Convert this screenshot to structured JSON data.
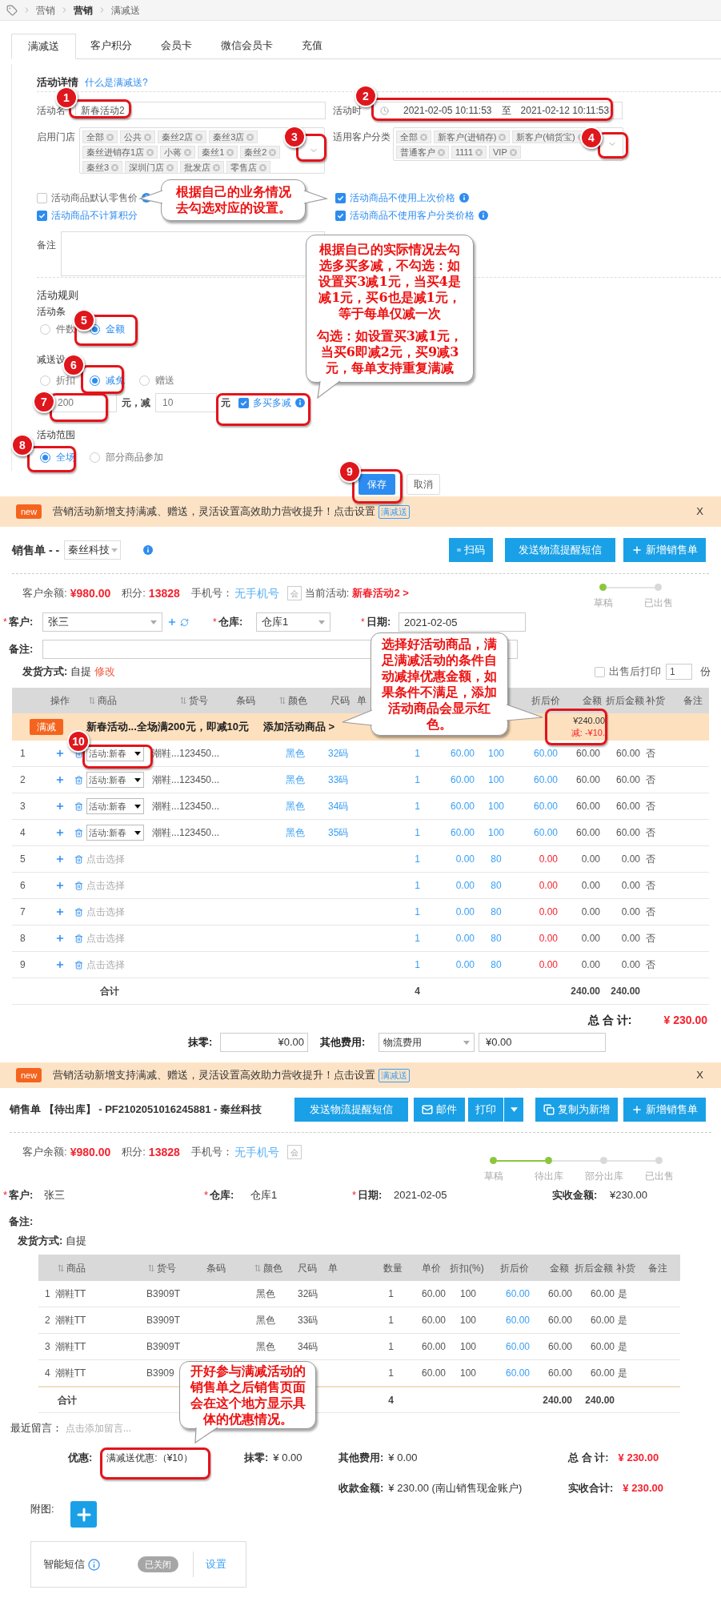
{
  "breadcrumb": [
    {
      "label": "营销",
      "selected": false
    },
    {
      "label": "营销",
      "selected": true
    },
    {
      "label": "满减送",
      "selected": false
    }
  ],
  "tabs": [
    {
      "label": "满减送",
      "selected": true
    },
    {
      "label": "客户积分",
      "selected": false
    },
    {
      "label": "会员卡",
      "selected": false
    },
    {
      "label": "微信会员卡",
      "selected": false
    },
    {
      "label": "充值",
      "selected": false
    }
  ],
  "activity_form": {
    "title": "活动详情",
    "help_link": "什么是满减送?",
    "name": {
      "label": "活动名",
      "value": "新春活动2"
    },
    "period": {
      "label": "活动时",
      "start": "2021-02-05 10:11:53",
      "separator": "至",
      "end": "2021-02-12 10:11:53"
    },
    "stores": {
      "label": "启用门店",
      "tags": [
        "全部",
        "公共",
        "秦丝2店",
        "秦丝3店",
        "秦丝进销存1店",
        "小蒋",
        "秦丝1",
        "秦丝2",
        "秦丝3",
        "深圳门店",
        "批发店",
        "零售店"
      ]
    },
    "customer_types": {
      "label": "适用客户分类",
      "tags": [
        "全部",
        "新客户(进销存)",
        "新客户(销货宝)",
        "普通客户",
        "1111",
        "VIP"
      ]
    },
    "options": [
      {
        "label": "活动商品默认零售价",
        "checked": false,
        "info": true
      },
      {
        "label": "活动商品不使用上次价格",
        "checked": true,
        "info": true
      },
      {
        "label": "活动商品不计算积分",
        "checked": true,
        "info": false
      },
      {
        "label": "活动商品不使用客户分类价格",
        "checked": true,
        "info": true
      }
    ],
    "note_label": "备注",
    "rules_title": "活动规则",
    "condition": {
      "label": "活动条",
      "options": [
        {
          "label": "件数",
          "selected": false
        },
        {
          "label": "金额",
          "selected": true
        }
      ]
    },
    "reduction": {
      "label": "减送设",
      "options": [
        {
          "label": "折扣",
          "selected": false
        },
        {
          "label": "减免",
          "selected": true
        },
        {
          "label": "赠送",
          "selected": false
        }
      ]
    },
    "threshold": "200",
    "threshold_suffix": "元，减",
    "amount": "10",
    "amount_suffix": "元",
    "repeat": {
      "label": "多买多减",
      "checked": true
    },
    "scope": {
      "label": "活动范围",
      "options": [
        {
          "label": "全场",
          "selected": true
        },
        {
          "label": "部分商品参加",
          "selected": false
        }
      ]
    },
    "buttons": [
      "保存",
      "取消"
    ]
  },
  "draft_order": {
    "banner": {
      "badge": "new",
      "text": "营销活动新增支持满减、赠送，灵活设置高效助力营收提升！点击设置",
      "link": "满减送",
      "close": "X"
    },
    "title": "销售单 - -",
    "company": "秦丝科技",
    "actions": [
      {
        "label": "扫码",
        "kind": "scan"
      },
      {
        "label": "发送物流提醒短信",
        "kind": "text"
      },
      {
        "label": "新增销售单",
        "kind": "add"
      }
    ],
    "balance": {
      "label": "客户余额:",
      "value": "¥980.00"
    },
    "points": {
      "label": "积分:",
      "value": "13828"
    },
    "phone": {
      "label": "手机号：",
      "value": "无手机号"
    },
    "member_badge": "会",
    "activity": {
      "label": "当前活动:",
      "value": "新春活动2 >"
    },
    "steps": [
      {
        "label": "草稿",
        "done": true
      },
      {
        "label": "已出售",
        "done": false
      }
    ],
    "customer": {
      "mark": "*",
      "label": "客户:",
      "value": "张三"
    },
    "warehouse": {
      "mark": "*",
      "label": "仓库:",
      "value": "仓库1"
    },
    "date": {
      "mark": "*",
      "label": "日期:",
      "value": "2021-02-05"
    },
    "note_label": "备注:",
    "shipping": {
      "label": "发货方式:",
      "value": "自提",
      "edit": "修改"
    },
    "print_after": {
      "label": "出售后打印",
      "checked": false,
      "copies": "1",
      "unit": "份"
    },
    "columns": [
      {
        "label": "操作",
        "sortable": false
      },
      {
        "label": "商品",
        "sortable": true
      },
      {
        "label": "货号",
        "sortable": true
      },
      {
        "label": "条码",
        "sortable": false
      },
      {
        "label": "颜色",
        "sortable": true
      },
      {
        "label": "尺码",
        "sortable": false
      },
      {
        "label": "单",
        "sortable": false
      },
      {
        "label": "折后价",
        "sortable": false
      },
      {
        "label": "金额",
        "sortable": false
      },
      {
        "label": "折后金额",
        "sortable": false
      },
      {
        "label": "补货",
        "sortable": false
      },
      {
        "label": "备注",
        "sortable": false
      }
    ],
    "promo": {
      "badge": "满减",
      "text": "新春活动...全场满200元，即减10元",
      "link": "添加活动商品 >",
      "amount": "¥240.00",
      "discount": "减: -¥10."
    },
    "rows": [
      {
        "kind": "product",
        "index": "1",
        "activity": "活动:新春",
        "product": "潮鞋...123450...",
        "color_name": "黑色",
        "size": "32码",
        "qty": "1",
        "price": "60.00",
        "discount": "100",
        "net_price": "60.00",
        "amount": "60.00",
        "net_amount": "60.00",
        "restock": "否"
      },
      {
        "kind": "product",
        "index": "2",
        "activity": "活动:新春",
        "product": "潮鞋...123450...",
        "color_name": "黑色",
        "size": "33码",
        "qty": "1",
        "price": "60.00",
        "discount": "100",
        "net_price": "60.00",
        "amount": "60.00",
        "net_amount": "60.00",
        "restock": "否"
      },
      {
        "kind": "product",
        "index": "3",
        "activity": "活动:新春",
        "product": "潮鞋...123450...",
        "color_name": "黑色",
        "size": "34码",
        "qty": "1",
        "price": "60.00",
        "discount": "100",
        "net_price": "60.00",
        "amount": "60.00",
        "net_amount": "60.00",
        "restock": "否"
      },
      {
        "kind": "product",
        "index": "4",
        "activity": "活动:新春",
        "product": "潮鞋...123450...",
        "color_name": "黑色",
        "size": "35码",
        "qty": "1",
        "price": "60.00",
        "discount": "100",
        "net_price": "60.00",
        "amount": "60.00",
        "net_amount": "60.00",
        "restock": "否"
      },
      {
        "kind": "empty",
        "index": "5",
        "placeholder": "点击选择",
        "qty": "1",
        "price": "0.00",
        "discount": "80",
        "net_price": "0.00",
        "amount": "0.00",
        "net_amount": "0.00",
        "restock": "否"
      },
      {
        "kind": "empty",
        "index": "6",
        "placeholder": "点击选择",
        "qty": "1",
        "price": "0.00",
        "discount": "80",
        "net_price": "0.00",
        "amount": "0.00",
        "net_amount": "0.00",
        "restock": "否"
      },
      {
        "kind": "empty",
        "index": "7",
        "placeholder": "点击选择",
        "qty": "1",
        "price": "0.00",
        "discount": "80",
        "net_price": "0.00",
        "amount": "0.00",
        "net_amount": "0.00",
        "restock": "否"
      },
      {
        "kind": "empty",
        "index": "8",
        "placeholder": "点击选择",
        "qty": "1",
        "price": "0.00",
        "discount": "80",
        "net_price": "0.00",
        "amount": "0.00",
        "net_amount": "0.00",
        "restock": "否"
      },
      {
        "kind": "empty",
        "index": "9",
        "placeholder": "点击选择",
        "qty": "1",
        "price": "0.00",
        "discount": "80",
        "net_price": "0.00",
        "amount": "0.00",
        "net_amount": "0.00",
        "restock": "否"
      }
    ],
    "total": {
      "label": "合计",
      "qty": "4",
      "amount": "240.00",
      "net_amount": "240.00"
    },
    "grand_total": {
      "label": "总 合 计:",
      "value": "¥ 230.00"
    },
    "rounding": {
      "label": "抹零:",
      "value": "¥0.00"
    },
    "other_fee": {
      "label": "其他费用:",
      "type": "物流费用",
      "value": "¥0.00"
    }
  },
  "pending_order": {
    "banner": {
      "badge": "new",
      "text": "营销活动新增支持满减、赠送，灵活设置高效助力营收提升！点击设置",
      "link": "满减送",
      "close": "X"
    },
    "title": "销售单 【待出库】 - PF2102051016245881 - 秦丝科技",
    "actions": [
      {
        "label": "发送物流提醒短信",
        "kind": "text"
      },
      {
        "label": "邮件",
        "kind": "mail"
      },
      {
        "label": "打印",
        "kind": "text",
        "split": true
      },
      {
        "label": "复制为新增",
        "kind": "copy"
      },
      {
        "label": "新增销售单",
        "kind": "add"
      }
    ],
    "balance": {
      "label": "客户余额:",
      "value": "¥980.00"
    },
    "points": {
      "label": "积分:",
      "value": "13828"
    },
    "phone": {
      "label": "手机号：",
      "value": "无手机号"
    },
    "member_badge": "会",
    "steps": [
      {
        "label": "草稿",
        "done": true
      },
      {
        "label": "待出库",
        "done": true
      },
      {
        "label": "部分出库",
        "done": false
      },
      {
        "label": "已出售",
        "done": false
      }
    ],
    "customer": {
      "mark": "*",
      "label": "客户:",
      "value": "张三"
    },
    "warehouse": {
      "mark": "*",
      "label": "仓库:",
      "value": "仓库1"
    },
    "date": {
      "mark": "*",
      "label": "日期:",
      "value": "2021-02-05"
    },
    "received": {
      "label": "实收金额:",
      "value": "¥230.00"
    },
    "note_label": "备注:",
    "shipping": {
      "label": "发货方式:",
      "value": "自提"
    },
    "columns": [
      {
        "label": "商品",
        "sortable": true
      },
      {
        "label": "货号",
        "sortable": true
      },
      {
        "label": "条码",
        "sortable": false
      },
      {
        "label": "颜色",
        "sortable": true
      },
      {
        "label": "尺码",
        "sortable": false
      },
      {
        "label": "单",
        "sortable": false
      },
      {
        "label": "数量",
        "sortable": false
      },
      {
        "label": "单价",
        "sortable": false
      },
      {
        "label": "折扣(%)",
        "sortable": false
      },
      {
        "label": "折后价",
        "sortable": false
      },
      {
        "label": "金额",
        "sortable": false
      },
      {
        "label": "折后金额",
        "sortable": false
      },
      {
        "label": "补货",
        "sortable": false
      },
      {
        "label": "备注",
        "sortable": false
      }
    ],
    "rows": [
      {
        "index": "1",
        "product": "潮鞋TT",
        "code": "B3909T",
        "color_name": "黑色",
        "size": "32码",
        "qty": "1",
        "price": "60.00",
        "discount": "100",
        "net_price": "60.00",
        "amount": "60.00",
        "net_amount": "60.00",
        "restock": "是"
      },
      {
        "index": "2",
        "product": "潮鞋TT",
        "code": "B3909T",
        "color_name": "黑色",
        "size": "33码",
        "qty": "1",
        "price": "60.00",
        "discount": "100",
        "net_price": "60.00",
        "amount": "60.00",
        "net_amount": "60.00",
        "restock": "是"
      },
      {
        "index": "3",
        "product": "潮鞋TT",
        "code": "B3909T",
        "color_name": "黑色",
        "size": "34码",
        "qty": "1",
        "price": "60.00",
        "discount": "100",
        "net_price": "60.00",
        "amount": "60.00",
        "net_amount": "60.00",
        "restock": "是"
      },
      {
        "index": "4",
        "product": "潮鞋TT",
        "code": "B3909",
        "qty": "1",
        "price": "60.00",
        "discount": "100",
        "net_price": "60.00",
        "amount": "60.00",
        "net_amount": "60.00",
        "restock": "是"
      }
    ],
    "total": {
      "label": "合计",
      "qty": "4",
      "amount": "240.00",
      "net_amount": "240.00"
    },
    "recent_message": {
      "label": "最近留言：",
      "placeholder": "点击添加留言..."
    },
    "discount": {
      "label": "优惠:",
      "value": "满减送优惠:（¥10）"
    },
    "rounding": {
      "label": "抹零:",
      "value": "¥ 0.00"
    },
    "other_fee": {
      "label": "其他费用:",
      "value": "¥ 0.00"
    },
    "grand_total": {
      "label": "总 合 计:",
      "value": "¥ 230.00"
    },
    "payment": {
      "label": "收款金额:",
      "value": "¥ 230.00 (南山销售现金账户)"
    },
    "received_total": {
      "label": "实收合计:",
      "value": "¥ 230.00"
    },
    "attachment_label": "附图:",
    "sms": {
      "label": "智能短信",
      "on": false,
      "status": "已关闭",
      "settings": "设置"
    }
  },
  "step_markers": [
    "1",
    "2",
    "3",
    "4",
    "5",
    "6",
    "7",
    "8",
    "9",
    "10"
  ],
  "callouts": [
    {
      "paragraphs": [
        "根据自己的业务情况去勾选对应的设置。"
      ]
    },
    {
      "paragraphs": [
        "根据自己的实际情况去勾选多买多减，不勾选：如设置买3减1元，当买4是减1元，买6也是减1元，等于每单仅减一次",
        "勾选：如设置买3减1元，当买6即减2元，买9减3元，每单支持重复满减"
      ]
    },
    {
      "paragraphs": [
        "选择好活动商品，满足满减活动的条件自动减掉优惠金额，如果条件不满足，添加活动商品会显示红色。"
      ]
    },
    {
      "paragraphs": [
        "开好参与满减活动的销售单之后销售页面会在这个地方显示具体的优惠情况。"
      ]
    }
  ]
}
